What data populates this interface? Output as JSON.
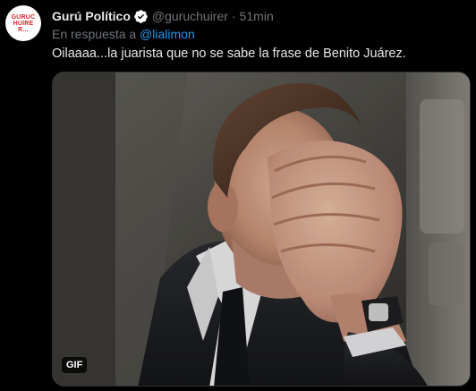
{
  "tweet": {
    "avatar_text": "GURUCHUIRER...",
    "display_name": "Gurú Político",
    "handle": "@guruchuirer",
    "separator": "·",
    "time": "51min",
    "reply_prefix": "En respuesta a ",
    "reply_mention": "@lialimon",
    "text": "Oilaaaa...la juarista que no se sabe la frase de Benito Juárez.",
    "media_badge": "GIF"
  },
  "colors": {
    "background": "#000000",
    "text_primary": "#e7e9ea",
    "text_secondary": "#71767b",
    "accent": "#1d9bf0",
    "avatar_brand": "#d6282d"
  },
  "icons": {
    "verified": "verified-badge-icon"
  }
}
